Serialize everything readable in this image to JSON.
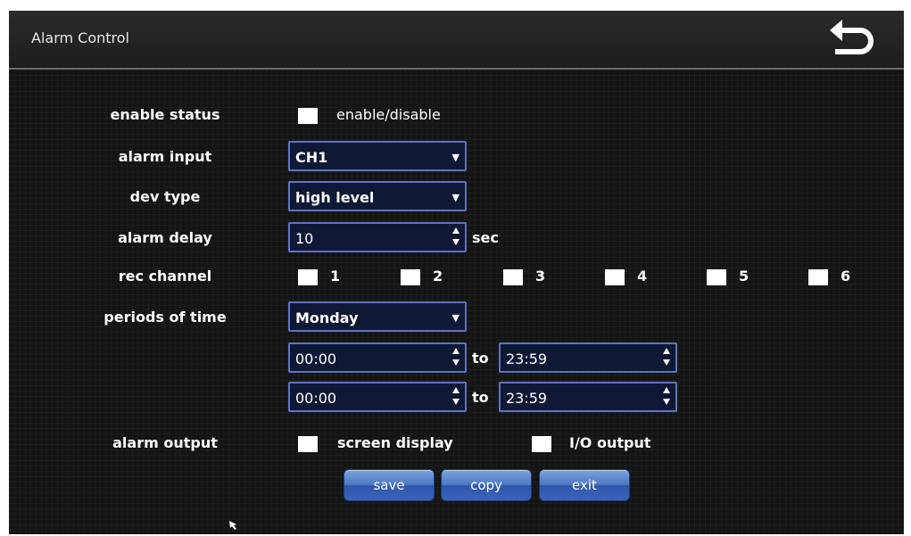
{
  "window": {
    "title": "Alarm Control",
    "back_icon": "back-arrow-icon"
  },
  "form": {
    "enable_status": {
      "label": "enable status",
      "checkbox_label": "enable/disable",
      "checked": false
    },
    "alarm_input": {
      "label": "alarm input",
      "value": "CH1"
    },
    "dev_type": {
      "label": "dev type",
      "value": "high level"
    },
    "alarm_delay": {
      "label": "alarm delay",
      "value": "10",
      "unit": "sec"
    },
    "rec_channel": {
      "label": "rec channel",
      "channels": [
        {
          "label": "1",
          "checked": false
        },
        {
          "label": "2",
          "checked": false
        },
        {
          "label": "3",
          "checked": false
        },
        {
          "label": "4",
          "checked": false
        },
        {
          "label": "5",
          "checked": false
        },
        {
          "label": "6",
          "checked": false
        }
      ]
    },
    "periods_of_time": {
      "label": "periods of time",
      "day": "Monday",
      "to_label": "to",
      "ranges": [
        {
          "from": "00:00",
          "to": "23:59"
        },
        {
          "from": "00:00",
          "to": "23:59"
        }
      ]
    },
    "alarm_output": {
      "label": "alarm output",
      "options": [
        {
          "label": "screen display",
          "checked": false
        },
        {
          "label": "I/O output",
          "checked": false
        }
      ]
    }
  },
  "buttons": {
    "save": "save",
    "copy": "copy",
    "exit": "exit"
  },
  "colors": {
    "background": "#171717",
    "field_bg": "#0f1935",
    "field_border": "#5e75bf",
    "button_blue": "#3a64b8",
    "text": "#ffffff"
  }
}
